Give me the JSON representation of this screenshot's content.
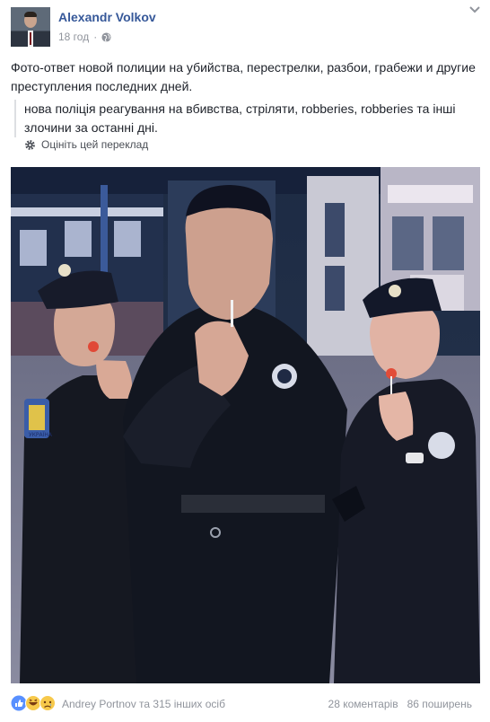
{
  "post": {
    "author": "Alexandr Volkov",
    "time": "18 год",
    "text": "Фото-ответ новой полиции на убийства, перестрелки, разбои, грабежи и другие преступления последних дней.",
    "translation": "нова поліція реагування на вбивства, стріляти, robberies, robberies та інші злочини за останні дні.",
    "rate_translation": "Оцініть цей переклад"
  },
  "photo": {
    "patch_text": "УКРАЇНА"
  },
  "footer": {
    "reactors": "Andrey Portnov та 315 інших осіб",
    "comments": "28 коментарів",
    "shares": "86 поширень"
  },
  "colors": {
    "link": "#365899",
    "muted": "#90949c",
    "like": "#5890ff",
    "haha": "#f7c94b"
  },
  "icons": [
    "chevron-down-icon",
    "globe-icon",
    "gear-icon",
    "like-reaction-icon",
    "haha-reaction-icon",
    "sad-reaction-icon"
  ]
}
